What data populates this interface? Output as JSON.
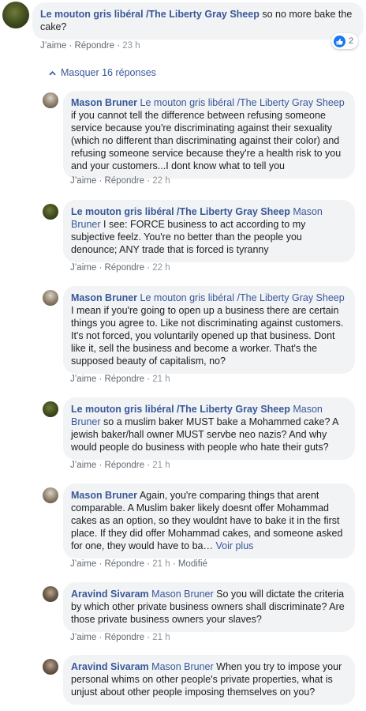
{
  "top_comment": {
    "author": "Le mouton gris libéral /The Liberty Gray Sheep",
    "text": "so no more bake the cake?",
    "like": "J’aime",
    "reply": "Répondre",
    "time": "23 h",
    "reaction_count": "2",
    "reaction_icon": "thumbs-up-icon"
  },
  "toggle": {
    "label": "Masquer 16 réponses",
    "icon": "chevron-up-icon"
  },
  "replies": [
    {
      "author": "Mason Bruner",
      "tag": "Le mouton gris libéral /The Liberty Gray Sheep",
      "text": "if you cannot tell the difference between refusing someone service because you're discriminating against their sexuality (which no different than discriminating against their color) and refusing someone service because they're a health risk to you and your customers...I dont know what to tell you",
      "like": "J’aime",
      "reply": "Répondre",
      "time": "22 h"
    },
    {
      "author": "Le mouton gris libéral /The Liberty Gray Sheep",
      "tag": "Mason Bruner",
      "text": "I see: FORCE business to act according to my subjective feelz. You're no better than the people you denounce; ANY trade that is forced is tyranny",
      "like": "J’aime",
      "reply": "Répondre",
      "time": "22 h"
    },
    {
      "author": "Mason Bruner",
      "tag": "Le mouton gris libéral /The Liberty Gray Sheep",
      "text": "I mean if you're going to open up a business there are certain things you agree to. Like not discriminating against customers. It's not forced, you voluntarily opened up that business. Dont like it, sell the business and become a worker. That's the supposed beauty of capitalism, no?",
      "like": "J’aime",
      "reply": "Répondre",
      "time": "21 h"
    },
    {
      "author": "Le mouton gris libéral /The Liberty Gray Sheep",
      "tag": "Mason Bruner",
      "text": "so a muslim baker MUST bake a Mohammed cake? A jewish baker/hall owner MUST servbe neo nazis? And why would people do business with people who hate their guts?",
      "like": "J’aime",
      "reply": "Répondre",
      "time": "21 h"
    },
    {
      "author": "Mason Bruner",
      "tag": "",
      "text": "Again, you're comparing things that arent comparable. A Muslim baker likely doesnt offer Mohammad cakes as an option, so they wouldnt have to bake it in the first place. If they did offer Mohammad cakes, and someone asked for one, they would have to ba…",
      "see_more": "Voir plus",
      "like": "J’aime",
      "reply": "Répondre",
      "time": "21 h",
      "edited": "Modifié"
    },
    {
      "author": "Aravind Sivaram",
      "tag": "Mason Bruner",
      "text": "So you will dictate the criteria by which other private business owners shall discriminate? Are those private business owners your slaves?",
      "like": "J’aime",
      "reply": "Répondre",
      "time": "21 h"
    },
    {
      "author": "Aravind Sivaram",
      "tag": "Mason Bruner",
      "text": "When you try to impose your personal whims on other people's private properties, what is unjust about other people imposing themselves on you?"
    }
  ],
  "sep": "·"
}
